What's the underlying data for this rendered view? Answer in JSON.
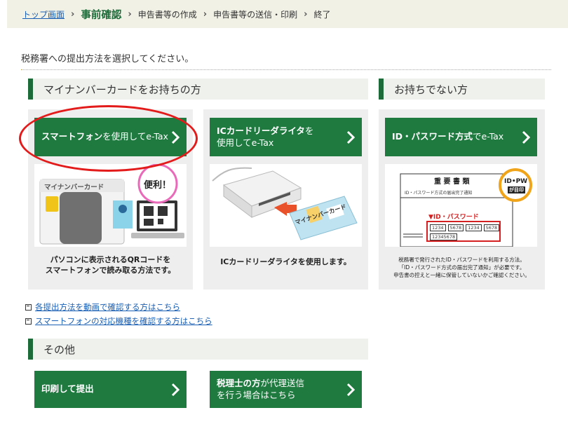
{
  "breadcrumb": {
    "top": "トップ画面",
    "current": "事前確認",
    "step3": "申告書等の作成",
    "step4": "申告書等の送信・印刷",
    "step5": "終了"
  },
  "lead_text": "税務署への提出方法を選択してください。",
  "sections": {
    "mynumber": "マイナンバーカードをお持ちの方",
    "no_card": "お持ちでない方",
    "other": "その他"
  },
  "options": {
    "smartphone": {
      "label_bold": "スマートフォン",
      "label_rest": "を使用してe-Tax",
      "desc_line1": "パソコンに表示されるQRコードを",
      "desc_line2": "スマートフォンで読み取る方法です。",
      "bubble": "便利！",
      "card_label": "マイナンバーカード"
    },
    "ic_reader": {
      "label_bold": "ICカードリーダライタ",
      "label_rest1": "を",
      "label_rest2": "使用してe-Tax",
      "desc": "ICカードリーダライタを使用します。",
      "card_label": "マイナンバーカード"
    },
    "id_password": {
      "label_bold": "ID・パスワード方式",
      "label_rest": "でe-Tax",
      "desc_line1": "税務署で発行されたID・パスワードを利用する方法。",
      "desc_line2": "「ID・パスワード方式の届出完了通知」が必要です。",
      "desc_line3": "申告書の控えと一緒に保管していないかご確認ください。",
      "doc_title": "重 要 書 類",
      "doc_sub": "ID・パスワード方式の届出完了通知",
      "badge_top": "ID•PW",
      "badge_bottom": "が目印",
      "doc_label": "▼ID・パスワード",
      "doc_nums": [
        "1234",
        "5678",
        "1234",
        "5678"
      ],
      "doc_num2": "12345678"
    }
  },
  "links": [
    "各提出方法を動画で確認する方はこちら",
    "スマートフォンの対応機種を確認する方はこちら"
  ],
  "other_buttons": {
    "print": "印刷して提出",
    "tax_accountant_bold": "税理士の方",
    "tax_accountant_rest1": "が代理送信",
    "tax_accountant_line2": "を行う場合はこちら"
  },
  "colors": {
    "green": "#1f7a40",
    "accent_red": "#e31b1b",
    "link": "#1a5fb4"
  }
}
